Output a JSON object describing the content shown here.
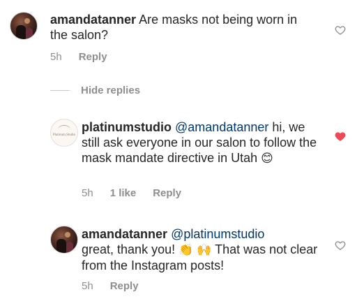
{
  "comments": [
    {
      "username": "amandatanner",
      "mention": "",
      "text": "Are masks not being worn in the salon?",
      "time": "5h",
      "likes": "",
      "reply_label": "Reply",
      "liked": false
    },
    {
      "username": "platinumstudio",
      "mention": "@amandatanner",
      "text": "hi, we still ask everyone in our salon to follow the mask mandate directive in Utah",
      "emoji": "😊",
      "time": "5h",
      "likes": "1 like",
      "reply_label": "Reply",
      "liked": true,
      "avatar_text": "Platinum Studio"
    },
    {
      "username": "amandatanner",
      "mention": "@platinumstudio",
      "text_before": "great, thank you!",
      "emoji_1": "👏",
      "emoji_2": "🙌",
      "text_after": "That was not clear from the Instagram posts!",
      "time": "5h",
      "reply_label": "Reply",
      "liked": false
    }
  ],
  "hide_replies_label": "Hide replies",
  "colors": {
    "liked_heart": "#ed4956",
    "mention": "#00376b",
    "meta": "#8e8e8e"
  }
}
